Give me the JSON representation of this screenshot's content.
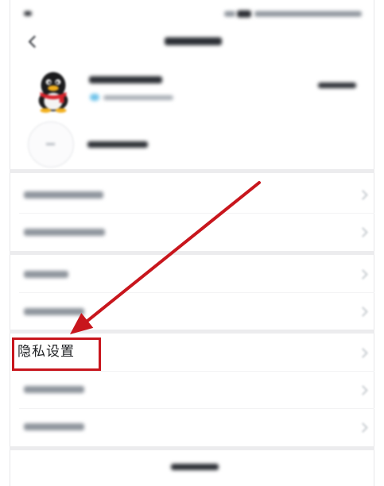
{
  "status_bar": {
    "icons": [
      "signal-icon",
      "wifi-icon",
      "battery-icon"
    ]
  },
  "header": {
    "back_icon": "back-arrow-icon"
  },
  "account": {
    "avatar_icon": "qq-penguin-icon",
    "status_dot_color": "#6fc3ea"
  },
  "add_account": {
    "icon": "add-account-icon"
  },
  "settings": {
    "privacy_label": "隐私设置",
    "chevron_icon": "chevron-right-icon"
  },
  "annotation": {
    "highlight_color": "#c8161d",
    "arrow_color": "#c8161d"
  }
}
